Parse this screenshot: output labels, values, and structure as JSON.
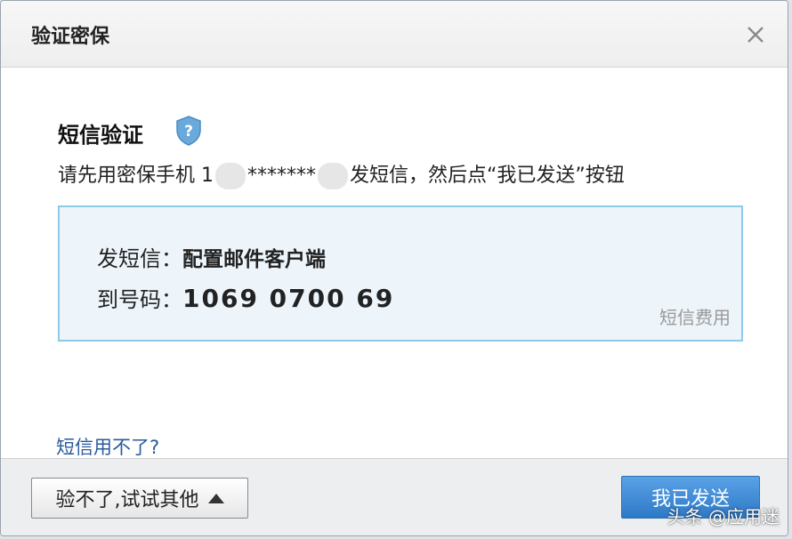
{
  "dialog": {
    "title": "验证密保",
    "close_icon": "close-icon"
  },
  "content": {
    "section_title": "短信验证",
    "help_icon": "shield-question-icon",
    "instruction_prefix": "请先用密保手机 1",
    "masked_digits": "*******",
    "instruction_suffix": "发短信，然后点“我已发送”按钮"
  },
  "info": {
    "send_label": "发短信：",
    "send_value": "配置邮件客户端",
    "to_label": "到号码：",
    "to_value": "1069 0700 69",
    "fee_link": "短信费用"
  },
  "links": {
    "sms_unavailable": "短信用不了?"
  },
  "footer": {
    "other_button": "验不了,试试其他",
    "sent_button": "我已发送"
  },
  "watermark": "头条 @应用迷",
  "colors": {
    "primary_button": "#2e79c7",
    "info_border": "#8fcbe8",
    "info_bg": "#edf4fa",
    "link": "#2a5a9e"
  }
}
